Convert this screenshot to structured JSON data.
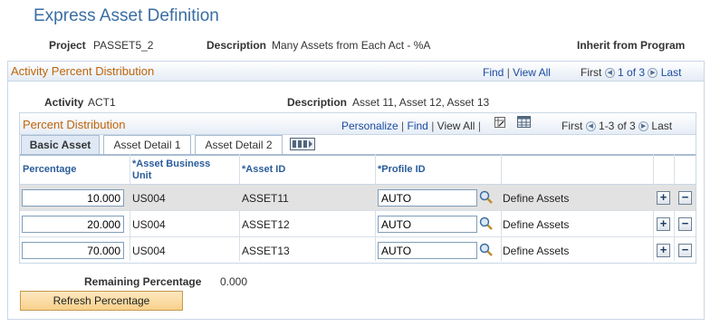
{
  "page": {
    "title": "Express Asset Definition"
  },
  "header": {
    "project_label": "Project",
    "project_value": "PASSET5_2",
    "description_label": "Description",
    "description_value": "Many Assets from Each Act - %A",
    "inherit_label": "Inherit from Program"
  },
  "activity_section": {
    "title": "Activity Percent Distribution",
    "find": "Find",
    "sep": "|",
    "view_all": "View All",
    "first": "First",
    "pager": "1 of 3",
    "last": "Last",
    "activity_label": "Activity",
    "activity_value": "ACT1",
    "description_label": "Description",
    "description_value": "Asset 11, Asset 12, Asset 13"
  },
  "distribution_section": {
    "title": "Percent Distribution",
    "personalize": "Personalize",
    "find": "Find",
    "view_all": "View All",
    "sep": "|",
    "first": "First",
    "pager": "1-3 of 3",
    "last": "Last"
  },
  "tabs": [
    {
      "label": "Basic Asset",
      "active": true
    },
    {
      "label": "Asset Detail 1",
      "active": false
    },
    {
      "label": "Asset Detail 2",
      "active": false
    }
  ],
  "grid": {
    "columns": {
      "percentage": "Percentage",
      "business_unit": "*Asset Business Unit",
      "asset_id": "*Asset ID",
      "profile_id": "*Profile ID"
    },
    "rows": [
      {
        "percentage": "10.000",
        "business_unit": "US004",
        "asset_id": "ASSET11",
        "profile_id": "AUTO",
        "link": "Define Assets"
      },
      {
        "percentage": "20.000",
        "business_unit": "US004",
        "asset_id": "ASSET12",
        "profile_id": "AUTO",
        "link": "Define Assets"
      },
      {
        "percentage": "70.000",
        "business_unit": "US004",
        "asset_id": "ASSET13",
        "profile_id": "AUTO",
        "link": "Define Assets"
      }
    ],
    "add_symbol": "+",
    "delete_symbol": "−"
  },
  "remaining": {
    "label": "Remaining Percentage",
    "value": "0.000"
  },
  "refresh_button": {
    "label": "Refresh Percentage"
  },
  "icons": {
    "lookup": "magnifier-icon",
    "personalize_grid": "grid-icon",
    "download": "spreadsheet-icon",
    "show_all_tabs": "show-all-columns-icon",
    "previous": "chevron-left-icon",
    "next": "chevron-right-icon"
  },
  "colors": {
    "title_blue": "#3a6da3",
    "section_title_orange": "#c0640a",
    "link_blue": "#1c4ca0",
    "selected_row": "#e2e2e2",
    "button_fill": "#f8d08a"
  }
}
